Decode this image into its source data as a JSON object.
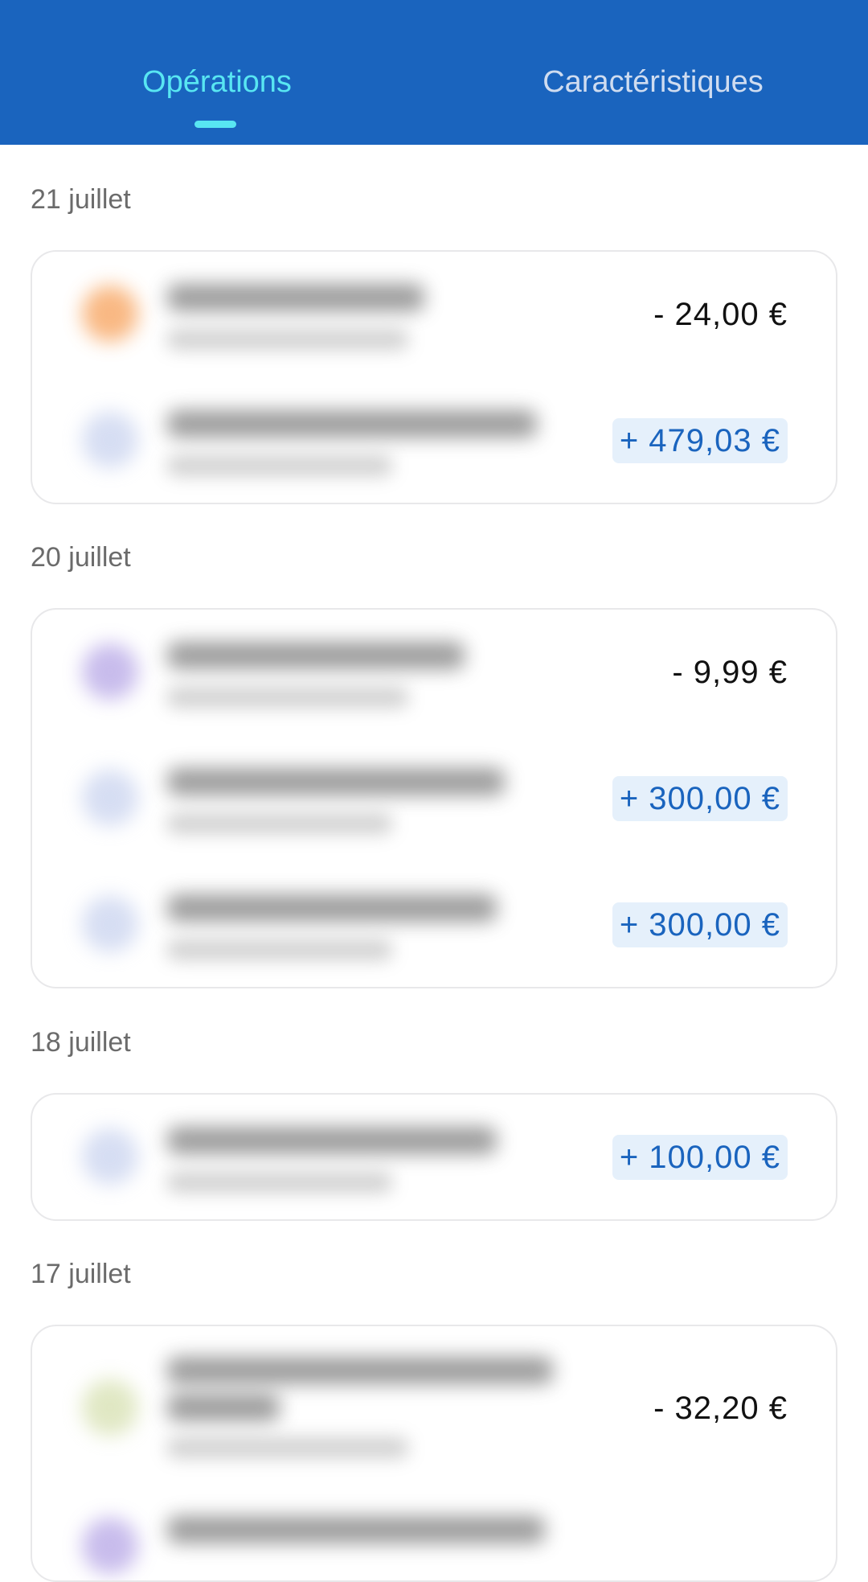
{
  "tabs": [
    {
      "label": "Opérations",
      "active": true
    },
    {
      "label": "Caractéristiques",
      "active": false
    }
  ],
  "groups": [
    {
      "date": "21 juillet",
      "transactions": [
        {
          "amount": "- 24,00 €",
          "type": "debit",
          "icon_color": "#f7a15a"
        },
        {
          "amount": "+ 479,03 €",
          "type": "credit",
          "icon_color": "#c9d3ef"
        }
      ]
    },
    {
      "date": "20 juillet",
      "transactions": [
        {
          "amount": "- 9,99 €",
          "type": "debit",
          "icon_color": "#b6a6e6"
        },
        {
          "amount": "+ 300,00 €",
          "type": "credit",
          "icon_color": "#c9d3ef"
        },
        {
          "amount": "+ 300,00 €",
          "type": "credit",
          "icon_color": "#c9d3ef"
        }
      ]
    },
    {
      "date": "18 juillet",
      "transactions": [
        {
          "amount": "+ 100,00 €",
          "type": "credit",
          "icon_color": "#c9d3ef"
        }
      ]
    },
    {
      "date": "17 juillet",
      "transactions": [
        {
          "amount": "- 32,20 €",
          "type": "debit",
          "icon_color": "#d6e0b0"
        }
      ]
    }
  ],
  "colors": {
    "header": "#1a64be",
    "tab_active": "#58e6f2",
    "tab_inactive": "#cfdcf0",
    "credit_text": "#1a64be",
    "credit_bg": "#e5f0fb"
  }
}
